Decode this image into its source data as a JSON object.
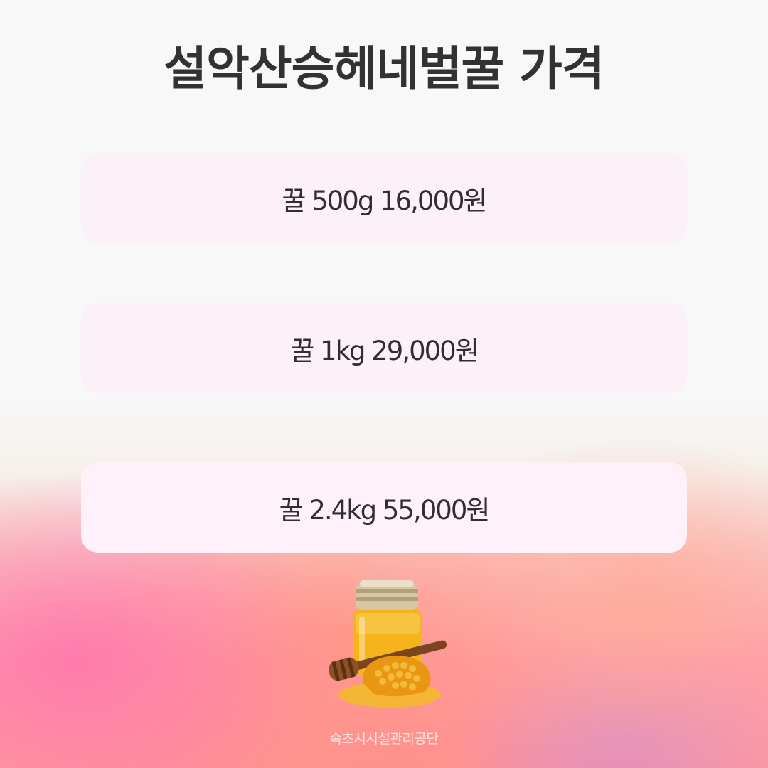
{
  "title": "설악산승헤네벌꿀 가격",
  "prices": [
    {
      "label": "꿀 500g 16,000원"
    },
    {
      "label": "꿀 1kg 29,000원"
    },
    {
      "label": "꿀 2.4kg 55,000원"
    }
  ],
  "image": {
    "icon": "honey-jar-icon"
  },
  "footer": "속초시시설관리공단",
  "colors": {
    "title": "#323232",
    "card_background": "#fdf1f9",
    "gradient_pink": "#ff9ab0",
    "gradient_peach": "#ff9a9a"
  }
}
